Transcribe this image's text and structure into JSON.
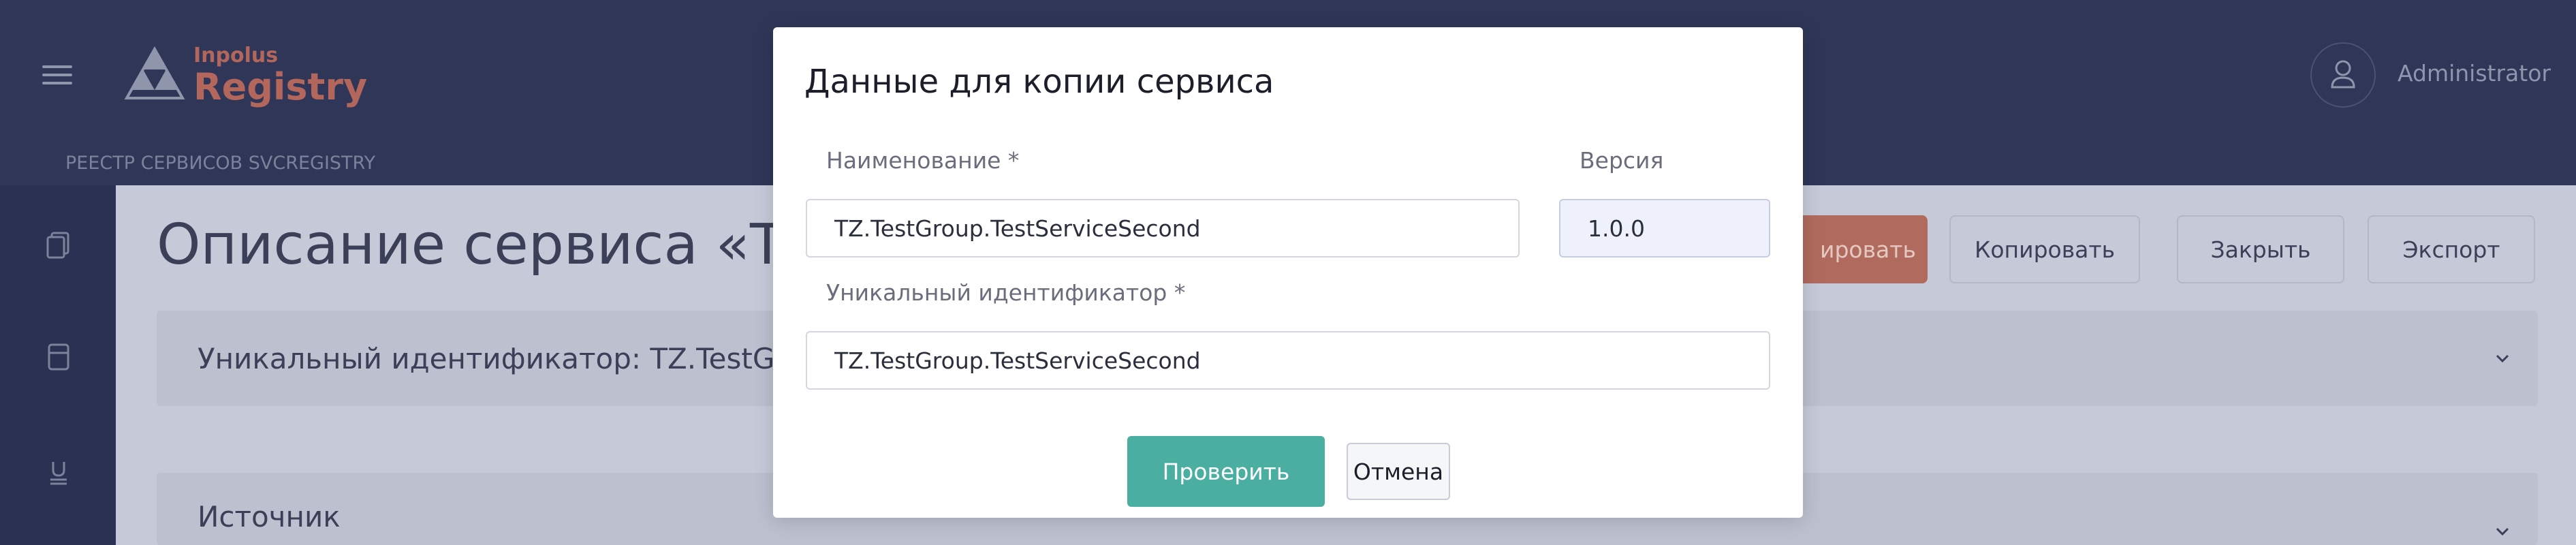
{
  "header": {
    "logo_small": "Inpolus",
    "logo_big": "Registry",
    "user_name": "Administrator"
  },
  "breadcrumb": "РЕЕСТР СЕРВИСОВ SVCREGISTRY",
  "sidebar": {
    "icons": [
      "documents-icon",
      "container-icon",
      "plug-icon"
    ]
  },
  "page": {
    "title": "Описание сервиса «TZ.T",
    "buttons": {
      "accent_label": "ировать",
      "copy_label": "Копировать",
      "close_label": "Закрыть",
      "export_label": "Экспорт"
    },
    "uid_card": "Уникальный идентификатор:  TZ.TestGroup.Te",
    "source_card": "Источник"
  },
  "modal": {
    "title": "Данные для копии сервиса",
    "name_label": "Наименование *",
    "name_value": "TZ.TestGroup.TestServiceSecond",
    "version_label": "Версия",
    "version_value": "1.0.0",
    "uid_label": "Уникальный идентификатор *",
    "uid_value": "TZ.TestGroup.TestServiceSecond",
    "check_label": "Проверить",
    "cancel_label": "Отмена"
  },
  "colors": {
    "header_bg": "#2f3658",
    "accent_teal": "#4aaea1",
    "accent_red": "#b06b5e"
  }
}
